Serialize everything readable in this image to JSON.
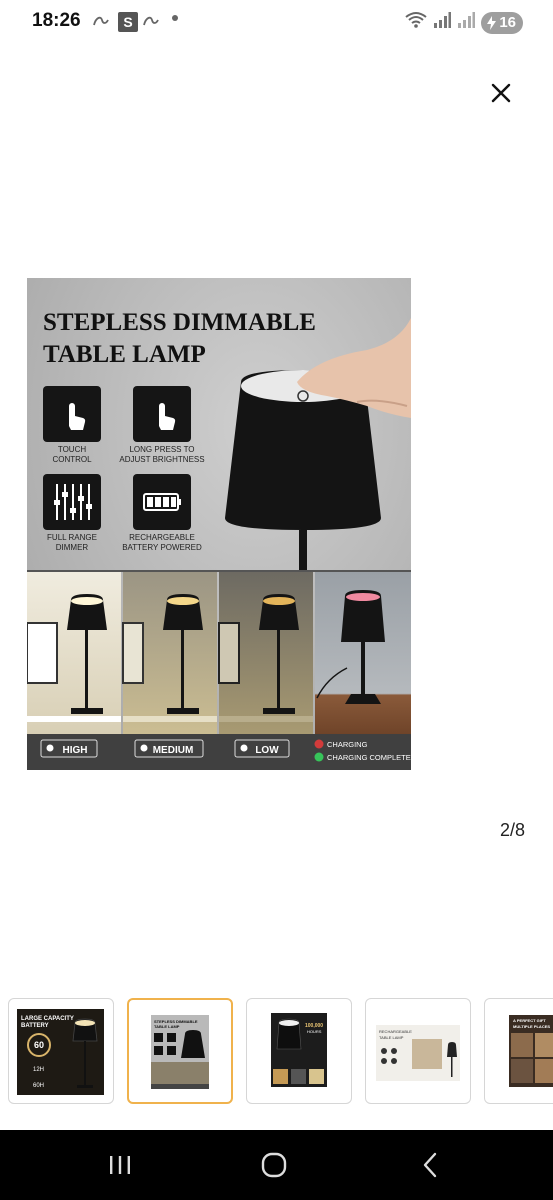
{
  "status_bar": {
    "time": "18:26",
    "notification_letter": "S",
    "battery_level": "16"
  },
  "viewer": {
    "counter": "2/8"
  },
  "product_image": {
    "title_line1": "STEPLESS DIMMABLE",
    "title_line2": "TABLE LAMP",
    "features": [
      {
        "line1": "TOUCH",
        "line2": "CONTROL"
      },
      {
        "line1": "LONG PRESS TO",
        "line2": "ADJUST BRIGHTNESS"
      },
      {
        "line1": "FULL RANGE",
        "line2": "DIMMER"
      },
      {
        "line1": "RECHARGEABLE",
        "line2": "BATTERY POWERED"
      }
    ],
    "levels": [
      "HIGH",
      "MEDIUM",
      "LOW"
    ],
    "charging_label": "CHARGING",
    "charging_completed_label": "CHARGING COMPLETED"
  },
  "thumbnails": [
    {
      "line1": "LARGE CAPACITY",
      "line2": "BATTERY",
      "badge": "60",
      "note1": "12H",
      "note2": "60H"
    },
    {
      "line1": "STEPLESS DIMMABLE",
      "line2": "TABLE LAMP"
    },
    {
      "line1": "100,000",
      "line2": "HOURS"
    },
    {
      "line1": "RECHARGEABLE",
      "line2": "TABLE LAMP"
    },
    {
      "line1": "A PERFECT GIFT",
      "line2": "MULTIPLE PLACES"
    }
  ],
  "colors": {
    "selected_border": "#f0b24c",
    "nav_bar": "#000000",
    "battery_pill": "#9e9e9e"
  }
}
